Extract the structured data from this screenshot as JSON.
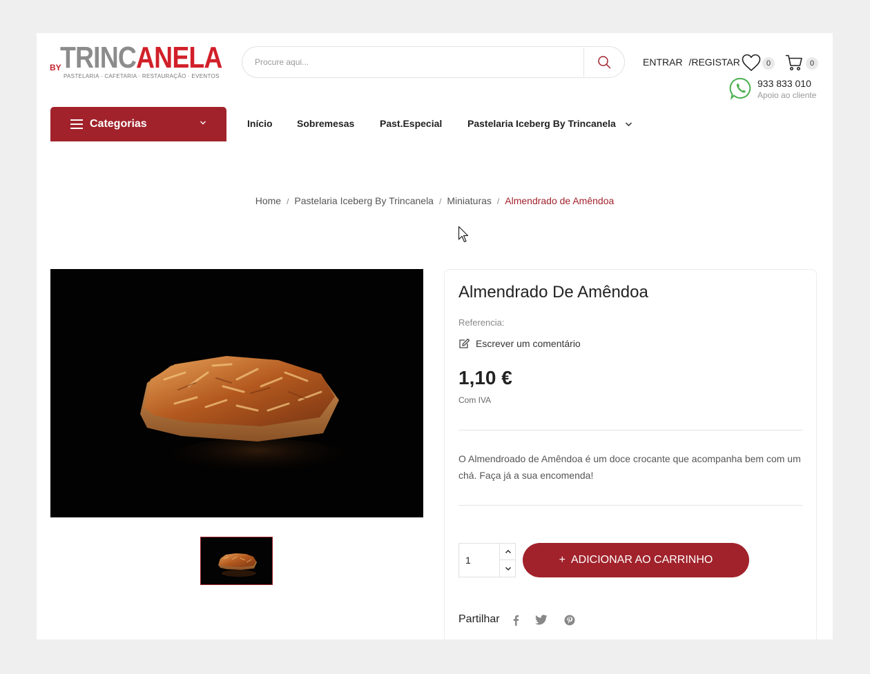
{
  "header": {
    "logo": {
      "by": "BY",
      "word_part1": "TRINC",
      "word_part2": "ANELA",
      "tagline": "PASTELARIA · CAFETARIA · RESTAURAÇÃO · EVENTOS"
    },
    "search": {
      "placeholder": "Procure aqui..."
    },
    "account": {
      "login": "ENTRAR",
      "separator": "/",
      "register": "REGISTAR"
    },
    "wishlist_count": "0",
    "cart_count": "0",
    "phone": {
      "number": "933 833 010",
      "label": "Apoio ao cliente"
    }
  },
  "nav": {
    "categories_label": "Categorias",
    "items": [
      "Início",
      "Sobremesas",
      "Past.Especial",
      "Pastelaria Iceberg By Trincanela"
    ]
  },
  "breadcrumb": {
    "items": [
      "Home",
      "Pastelaria Iceberg By Trincanela",
      "Miniaturas"
    ],
    "current": "Almendrado de Amêndoa",
    "separator": "/"
  },
  "product": {
    "name": "Almendrado De Amêndoa",
    "reference_label": "Referencia:",
    "write_comment": "Escrever um comentário",
    "price": "1,10 €",
    "vat_label": "Com IVA",
    "description": "O Almendroado de Amêndoa é um doce crocante que acompanha bem com um chá. Faça já a sua encomenda!",
    "quantity": "1",
    "add_to_cart": "ADICIONAR AO CARRINHO",
    "share_label": "Partilhar"
  },
  "colors": {
    "brand": "#a1222b",
    "logo_red": "#d1202a",
    "logo_grey": "#8c8c8c",
    "whatsapp": "#4caf50"
  }
}
